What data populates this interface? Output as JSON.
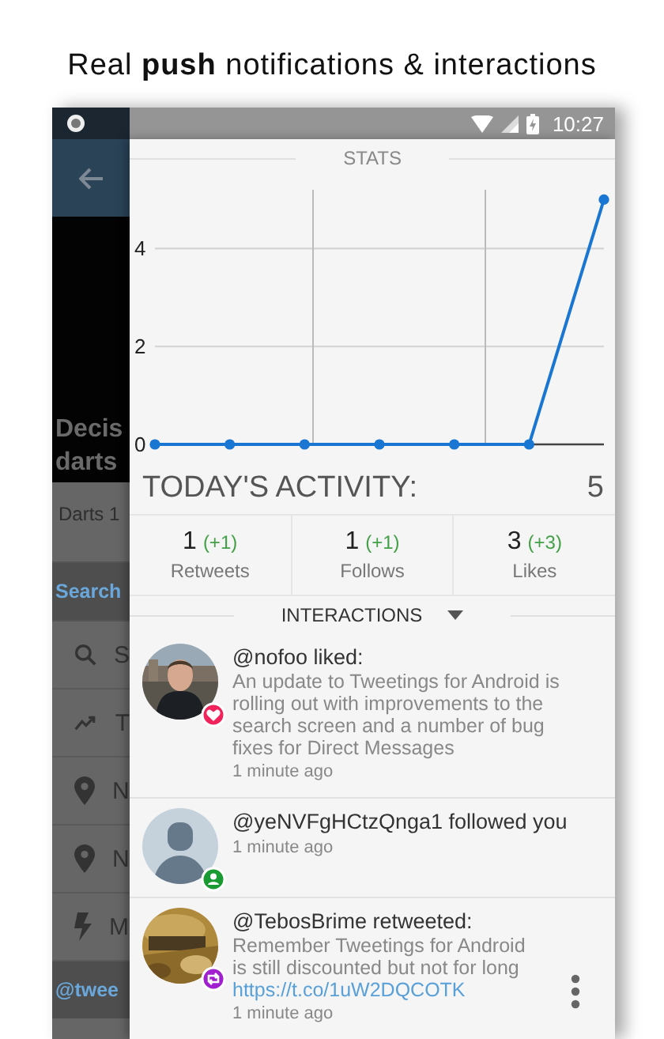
{
  "caption": "Real **push** notifications & interactions",
  "status_bar": {
    "time": "10:27"
  },
  "background_app": {
    "title_lines": [
      "Decis",
      "darts"
    ],
    "subtitle": "Darts 1",
    "section": "Search",
    "account": "@twee",
    "items": [
      {
        "kind": "search",
        "label": "S"
      },
      {
        "kind": "trending",
        "label": "T"
      },
      {
        "kind": "place",
        "label": "N"
      },
      {
        "kind": "place",
        "label": "N"
      },
      {
        "kind": "flash",
        "label": "M"
      }
    ]
  },
  "stats": {
    "title": "STATS",
    "chart_data": {
      "type": "line",
      "categories": [
        null,
        null,
        null,
        null,
        null,
        null,
        null
      ],
      "ylim": [
        0,
        5.2
      ],
      "yticks": [
        0,
        2,
        4
      ],
      "series": [
        {
          "color": "#1976d2",
          "marker": "circle",
          "values": [
            0,
            0,
            0,
            0,
            0,
            0,
            5
          ]
        }
      ]
    }
  },
  "activity": {
    "label": "TODAY'S ACTIVITY:",
    "total": "5"
  },
  "counters": [
    {
      "value": "1",
      "delta": "(+1)",
      "label": "Retweets"
    },
    {
      "value": "1",
      "delta": "(+1)",
      "label": "Follows"
    },
    {
      "value": "3",
      "delta": "(+3)",
      "label": "Likes"
    }
  ],
  "interactions": {
    "title": "INTERACTIONS",
    "items": [
      {
        "badge": {
          "kind": "like"
        },
        "color": "#f0245a",
        "title": "@nofoo liked:",
        "text": "An update to Tweetings for Android is rolling out with improvements to the search screen and a number of bug fixes for Direct Messages",
        "time": "1 minute ago",
        "menu": false
      },
      {
        "avatar": {
          "kind": "default"
        },
        "badge": {
          "kind": "follow"
        },
        "color": "#1a9a32",
        "title": "@yeNVFgHCtzQnga1 followed you",
        "time": "1 minute ago",
        "menu": false
      },
      {
        "avatar": {
          "kind": "photo2"
        },
        "badge": {
          "kind": "retweet"
        },
        "color": "#a020d0",
        "title": "@TebosBrime retweeted:",
        "text": "Remember Tweetings for Android\nis still discounted but not for long",
        "link": "https://t.co/1uW2DQCOTK",
        "time": "1 minute ago",
        "menu": true
      }
    ]
  }
}
